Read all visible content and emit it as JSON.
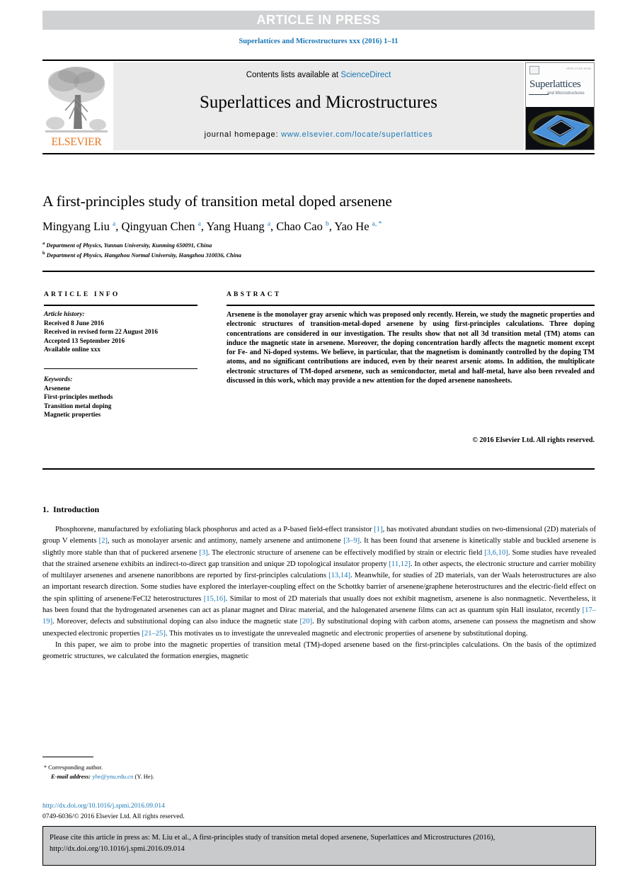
{
  "banner": {
    "text": "ARTICLE IN PRESS",
    "bg_color": "#d0d1d3",
    "text_color": "#ffffff"
  },
  "journal_ref": "Superlattices and Microstructures xxx (2016) 1–11",
  "accent_color": "#1b77b5",
  "masthead": {
    "contents_prefix": "Contents lists available at ",
    "contents_link": "ScienceDirect",
    "journal_title": "Superlattices and Microstructures",
    "homepage_prefix": "journal homepage: ",
    "homepage_url": "www.elsevier.com/locate/superlattices",
    "publisher_logo_text": "ELSEVIER",
    "publisher_logo_color": "#e87722",
    "cover": {
      "title": "Superlattices",
      "subtitle": "and Microstructures",
      "meta": "ISSN 0749-6036"
    }
  },
  "article": {
    "title": "A first-principles study of transition metal doped arsenene",
    "authors": [
      {
        "name": "Mingyang Liu",
        "marks": "a"
      },
      {
        "name": "Qingyuan Chen",
        "marks": "a"
      },
      {
        "name": "Yang Huang",
        "marks": "a"
      },
      {
        "name": "Chao Cao",
        "marks": "b"
      },
      {
        "name": "Yao He",
        "marks": "a, *"
      }
    ],
    "affiliations": [
      {
        "mark": "a",
        "text": "Department of Physics, Yunnan University, Kunming 650091, China"
      },
      {
        "mark": "b",
        "text": "Department of Physics, Hangzhou Normal University, Hangzhou 310036, China"
      }
    ]
  },
  "article_info": {
    "label": "ARTICLE INFO",
    "history_heading": "Article history:",
    "history": [
      "Received 8 June 2016",
      "Received in revised form 22 August 2016",
      "Accepted 13 September 2016",
      "Available online xxx"
    ],
    "keywords_heading": "Keywords:",
    "keywords": [
      "Arsenene",
      "First-principles methods",
      "Transition metal doping",
      "Magnetic properties"
    ]
  },
  "abstract": {
    "label": "ABSTRACT",
    "text": "Arsenene is the monolayer gray arsenic which was proposed only recently. Herein, we study the magnetic properties and electronic structures of transition-metal-doped arsenene by using first-principles calculations. Three doping concentrations are considered in our investigation. The results show that not all 3d transition metal (TM) atoms can induce the magnetic state in arsenene. Moreover, the doping concentration hardly affects the magnetic moment except for Fe- and Ni-doped systems. We believe, in particular, that the magnetism is dominantly controlled by the doping TM atoms, and no significant contributions are induced, even by their nearest arsenic atoms. In addition, the multiplicate electronic structures of TM-doped arsenene, such as semiconductor, metal and half-metal, have also been revealed and discussed in this work, which may provide a new attention for the doped arsenene nanosheets.",
    "copyright": "© 2016 Elsevier Ltd. All rights reserved."
  },
  "body": {
    "section_number": "1.",
    "section_title": "Introduction",
    "paragraphs": [
      "Phosphorene, manufactured by exfoliating black phosphorus and acted as a P-based field-effect transistor [1], has motivated abundant studies on two-dimensional (2D) materials of group V elements [2], such as monolayer arsenic and antimony, namely arsenene and antimonene [3–9]. It has been found that arsenene is kinetically stable and buckled arsenene is slightly more stable than that of puckered arsenene [3]. The electronic structure of arsenene can be effectively modified by strain or electric field [3,6,10]. Some studies have revealed that the strained arsenene exhibits an indirect-to-direct gap transition and unique 2D topological insulator property [11,12]. In other aspects, the electronic structure and carrier mobility of multilayer arsenenes and arsenene nanoribbons are reported by first-principles calculations [13,14]. Meanwhile, for studies of 2D materials, van der Waals heterostructures are also an important research direction. Some studies have explored the interlayer-coupling effect on the Schottky barrier of arsenene/graphene heterostructures and the electric-field effect on the spin splitting of arsenene/FeCl2 heterostructures [15,16]. Similar to most of 2D materials that usually does not exhibit magnetism, arsenene is also nonmagnetic. Nevertheless, it has been found that the hydrogenated arsenenes can act as planar magnet and Dirac material, and the halogenated arsenene films can act as quantum spin Hall insulator, recently [17–19]. Moreover, defects and substitutional doping can also induce the magnetic state [20]. By substitutional doping with carbon atoms, arsenene can possess the magnetism and show unexpected electronic properties [21–25]. This motivates us to investigate the unrevealed magnetic and electronic properties of arsenene by substitutional doping.",
      "In this paper, we aim to probe into the magnetic properties of transition metal (TM)-doped arsenene based on the first-principles calculations. On the basis of the optimized geometric structures, we calculated the formation energies, magnetic"
    ]
  },
  "footnote": {
    "corresponding_marker": "*",
    "corresponding_text": "Corresponding author.",
    "email_label": "E-mail address:",
    "email": "yhe@ynu.edu.cn",
    "email_owner": "(Y. He)."
  },
  "footer": {
    "doi": "http://dx.doi.org/10.1016/j.spmi.2016.09.014",
    "issn": "0749-6036/© 2016 Elsevier Ltd. All rights reserved."
  },
  "cite_box": {
    "text": "Please cite this article in press as: M. Liu et al., A first-principles study of transition metal doped arsenene, Superlattices and Microstructures (2016), http://dx.doi.org/10.1016/j.spmi.2016.09.014",
    "bg_color": "#c9cacc"
  }
}
